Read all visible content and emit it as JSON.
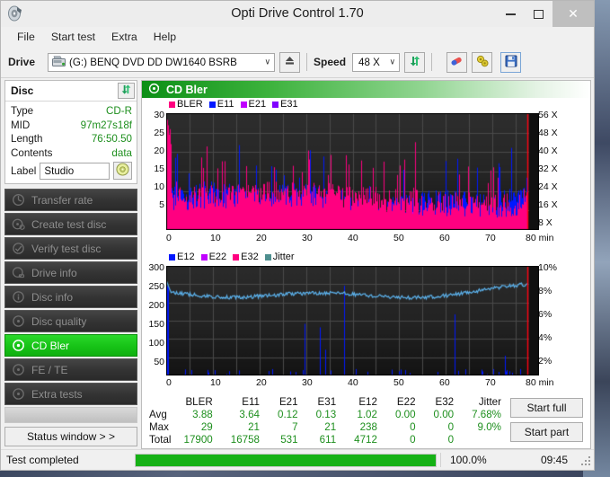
{
  "window": {
    "title": "Opti Drive Control 1.70",
    "app_icon": "disc-icon",
    "minimize": "–",
    "maximize": "☐",
    "close": "✕"
  },
  "menu": {
    "items": [
      "File",
      "Start test",
      "Extra",
      "Help"
    ]
  },
  "toolbar": {
    "drive_label": "Drive",
    "drive_value": "(G:)   BENQ DVD DD DW1640 BSRB",
    "speed_label": "Speed",
    "speed_value": "48 X",
    "caret": "∨",
    "eject_icon": "eject-icon",
    "refresh_icon": "refresh-icon",
    "erase_icon": "erase-disc-icon",
    "settings_icon": "settings-icon",
    "save_icon": "save-icon"
  },
  "disc_panel": {
    "title": "Disc",
    "refresh_icon": "refresh-icon",
    "rows": [
      {
        "key": "Type",
        "value": "CD-R"
      },
      {
        "key": "MID",
        "value": "97m27s18f"
      },
      {
        "key": "Length",
        "value": "76:50.50"
      },
      {
        "key": "Contents",
        "value": "data"
      }
    ],
    "label_key": "Label",
    "label_value": "Studio",
    "label_placeholder": "",
    "disc_icon": "cd-disc-icon"
  },
  "nav": {
    "items": [
      {
        "label": "Transfer rate",
        "icon": "transfer-rate-icon",
        "active": false
      },
      {
        "label": "Create test disc",
        "icon": "create-test-disc-icon",
        "active": false
      },
      {
        "label": "Verify test disc",
        "icon": "verify-test-disc-icon",
        "active": false
      },
      {
        "label": "Drive info",
        "icon": "drive-info-icon",
        "active": false
      },
      {
        "label": "Disc info",
        "icon": "disc-info-icon",
        "active": false
      },
      {
        "label": "Disc quality",
        "icon": "disc-quality-icon",
        "active": false
      },
      {
        "label": "CD Bler",
        "icon": "cd-bler-icon",
        "active": true
      },
      {
        "label": "FE / TE",
        "icon": "fe-te-icon",
        "active": false
      },
      {
        "label": "Extra tests",
        "icon": "extra-tests-icon",
        "active": false
      }
    ],
    "status_window": "Status window > >"
  },
  "panel": {
    "title": "CD Bler",
    "icon": "cd-bler-icon"
  },
  "chart_data": [
    {
      "type": "line",
      "title": "CD Bler error rates",
      "xlabel": "min",
      "ylabel": "",
      "x_ticks": [
        "0",
        "10",
        "20",
        "30",
        "40",
        "50",
        "60",
        "70",
        "80 min"
      ],
      "xlim": [
        0,
        80
      ],
      "y_ticks": [
        "30",
        "25",
        "20",
        "15",
        "10",
        "5"
      ],
      "ylim": [
        0,
        30
      ],
      "y2_ticks": [
        "56 X",
        "48 X",
        "40 X",
        "32 X",
        "24 X",
        "16 X",
        "8 X"
      ],
      "y2lim": [
        0,
        60
      ],
      "grid": true,
      "legend_position": "top-left",
      "legend": [
        {
          "name": "BLER",
          "color": "#ff0080"
        },
        {
          "name": "E11",
          "color": "#0018ff"
        },
        {
          "name": "E21",
          "color": "#c000ff"
        },
        {
          "name": "E31",
          "color": "#8000ff"
        }
      ],
      "series": [
        {
          "name": "BLER",
          "color": "#ff0080",
          "avg": 3.88,
          "max": 29,
          "total": 17900
        },
        {
          "name": "E11",
          "color": "#0018ff",
          "avg": 3.64,
          "max": 21,
          "total": 16758
        },
        {
          "name": "E21",
          "color": "#c000ff",
          "avg": 0.12,
          "max": 7,
          "total": 531
        },
        {
          "name": "E31",
          "color": "#8000ff",
          "avg": 0.13,
          "max": 21,
          "total": 611
        }
      ]
    },
    {
      "type": "line",
      "title": "CD Bler E12 / jitter",
      "xlabel": "min",
      "ylabel": "",
      "x_ticks": [
        "0",
        "10",
        "20",
        "30",
        "40",
        "50",
        "60",
        "70",
        "80 min"
      ],
      "xlim": [
        0,
        80
      ],
      "y_ticks": [
        "300",
        "250",
        "200",
        "150",
        "100",
        "50"
      ],
      "ylim": [
        0,
        300
      ],
      "y2_ticks": [
        "10%",
        "8%",
        "6%",
        "4%",
        "2%"
      ],
      "y2lim": [
        0,
        10
      ],
      "grid": true,
      "legend_position": "top-left",
      "legend": [
        {
          "name": "E12",
          "color": "#0018ff"
        },
        {
          "name": "E22",
          "color": "#c000ff"
        },
        {
          "name": "E32",
          "color": "#ff0080"
        },
        {
          "name": "Jitter",
          "color": "#4e8f8f"
        }
      ],
      "series": [
        {
          "name": "E12",
          "color": "#0018ff",
          "avg": 1.02,
          "max": 238,
          "total": 4712
        },
        {
          "name": "E22",
          "color": "#c000ff",
          "avg": 0.0,
          "max": 0,
          "total": 0
        },
        {
          "name": "E32",
          "color": "#ff0080",
          "avg": 0.0,
          "max": 0,
          "total": 0
        },
        {
          "name": "Jitter",
          "color": "#4fa3e0",
          "avg": "7.68%",
          "max": "9.0%",
          "total": ""
        }
      ]
    }
  ],
  "stats": {
    "columns": [
      "BLER",
      "E11",
      "E21",
      "E31",
      "E12",
      "E22",
      "E32",
      "Jitter"
    ],
    "rows": [
      {
        "label": "Avg",
        "values": [
          "3.88",
          "3.64",
          "0.12",
          "0.13",
          "1.02",
          "0.00",
          "0.00",
          "7.68%"
        ]
      },
      {
        "label": "Max",
        "values": [
          "29",
          "21",
          "7",
          "21",
          "238",
          "0",
          "0",
          "9.0%"
        ]
      },
      {
        "label": "Total",
        "values": [
          "17900",
          "16758",
          "531",
          "611",
          "4712",
          "0",
          "0",
          ""
        ]
      }
    ]
  },
  "actions": {
    "start_full": "Start full",
    "start_part": "Start part"
  },
  "statusbar": {
    "text": "Test completed",
    "progress_percent": "100.0%",
    "progress_value": 100,
    "elapsed": "09:45"
  },
  "colors": {
    "accent_green": "#15b115",
    "value_green": "#1e8f1e",
    "bler_pink": "#ff0080",
    "e11_blue": "#0018ff",
    "jitter_blue": "#4fa3e0",
    "chart_bg": "#1b1b1b"
  }
}
